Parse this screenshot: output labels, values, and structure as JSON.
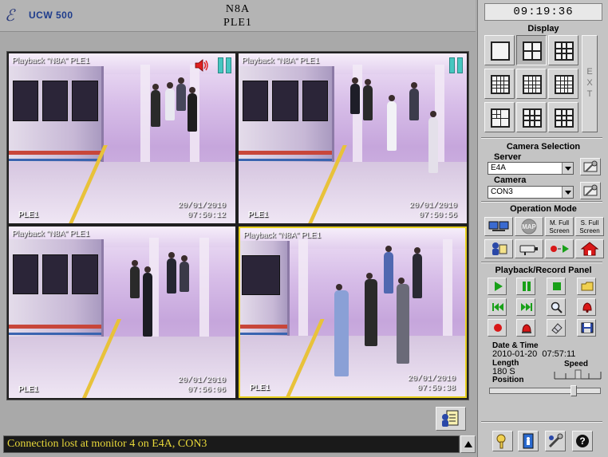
{
  "header": {
    "logo_text": "UCW 500",
    "station": "N8A",
    "camera": "PLE1"
  },
  "tiles": [
    {
      "label": "Playback \"N8A\" PLE1",
      "name": "PLE1",
      "date": "20/01/2010",
      "time": "07:50:12",
      "audio": true,
      "selected": false
    },
    {
      "label": "Playback \"N8A\" PLE1",
      "name": "PLE1",
      "date": "20/01/2010",
      "time": "07:50:56",
      "audio": false,
      "selected": false
    },
    {
      "label": "Playback \"N8A\" PLE1",
      "name": "PLE1",
      "date": "20/01/2010",
      "time": "07:56:06",
      "audio": false,
      "selected": false
    },
    {
      "label": "Playback \"N8A\" PLE1",
      "name": "PLE1",
      "date": "20/01/2010",
      "time": "07:59:38",
      "audio": false,
      "selected": true
    }
  ],
  "status_bar": {
    "message": "Connection lost at monitor 4 on E4A, CON3",
    "color": "#e8d83a"
  },
  "panel": {
    "clock": "09:19:36",
    "display": {
      "title": "Display",
      "ext_label": "EXT",
      "active_layout": "2x2"
    },
    "camera_selection": {
      "title": "Camera Selection",
      "server_label": "Server",
      "server_value": "E4A",
      "camera_label": "Camera",
      "camera_value": "CON3"
    },
    "operation_mode": {
      "title": "Operation Mode",
      "map_label": "MAP",
      "m_full_label": "M. Full Screen",
      "s_full_label": "S. Full Screen"
    },
    "playback": {
      "title": "Playback/Record Panel",
      "date_time_label": "Date & Time",
      "date_time_value": "2010-01-20  07:57:11",
      "length_label": "Length",
      "length_value": "180 S",
      "speed_label": "Speed",
      "position_label": "Position",
      "position_fraction": 0.78,
      "speed_fraction": 0.5
    }
  },
  "colors": {
    "accent_record": "#d81818",
    "accent_play": "#18a018",
    "selected_tile_border": "#e8d020"
  }
}
